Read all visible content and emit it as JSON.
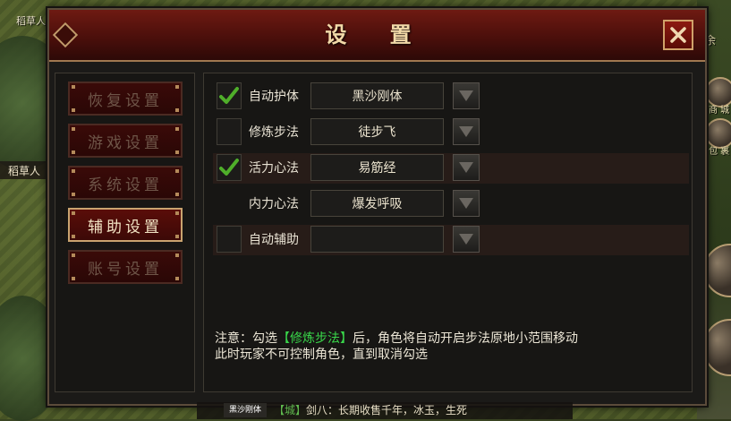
{
  "background": {
    "scarecrow_top": "稻草人",
    "scarecrow_tag": "稻草人",
    "right_top_text": "余",
    "right_shop": "商 城",
    "right_pack": "包 裹"
  },
  "dialog": {
    "title": "设 置",
    "close_icon": "close-x",
    "nav": [
      {
        "label": "恢复设置",
        "active": false
      },
      {
        "label": "游戏设置",
        "active": false
      },
      {
        "label": "系统设置",
        "active": false
      },
      {
        "label": "辅助设置",
        "active": true
      },
      {
        "label": "账号设置",
        "active": false
      }
    ],
    "options": [
      {
        "label": "自动护体",
        "checked": true,
        "value": "黑沙刚体",
        "has_checkbox": true
      },
      {
        "label": "修炼步法",
        "checked": false,
        "value": "徒步飞",
        "has_checkbox": true
      },
      {
        "label": "活力心法",
        "checked": true,
        "value": "易筋经",
        "has_checkbox": true
      },
      {
        "label": "内力心法",
        "checked": false,
        "value": "爆发呼吸",
        "has_checkbox": false
      },
      {
        "label": "自动辅助",
        "checked": false,
        "value": "",
        "has_checkbox": true
      }
    ],
    "note": {
      "prefix": "注意：勾选",
      "highlight": "【修炼步法】",
      "suffix": "后，角色将自动开启步法原地小范围移动",
      "line2": "此时玩家不可控制角色，直到取消勾选"
    }
  },
  "chat": {
    "button": "黑沙刚体",
    "channel": "【城】",
    "text": "剑八：长期收售千年，冰玉，生死"
  },
  "colors": {
    "title_bar": "#4b0f0b",
    "highlight_green": "#39d64a",
    "check_green": "#4fae2a",
    "gold_border": "#c9a36f"
  }
}
